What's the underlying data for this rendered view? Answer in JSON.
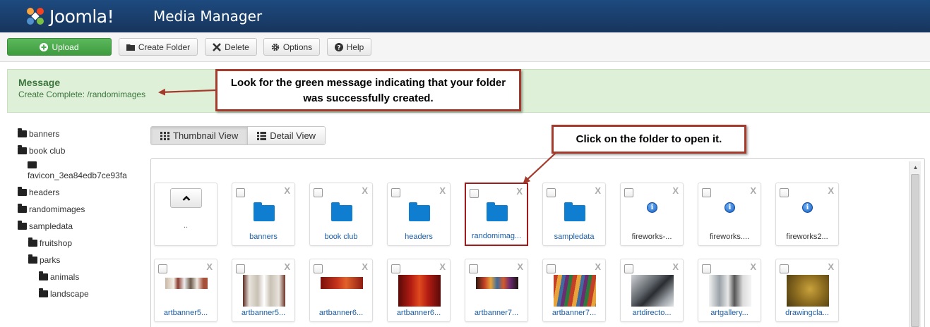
{
  "header": {
    "brand": "Joomla!",
    "title": "Media Manager"
  },
  "toolbar": {
    "upload": "Upload",
    "create_folder": "Create Folder",
    "delete": "Delete",
    "options": "Options",
    "help": "Help"
  },
  "message": {
    "heading": "Message",
    "text": "Create Complete: /randomimages"
  },
  "callouts": {
    "message_note": "Look for the green message indicating that your folder was successfully created.",
    "folder_note": "Click on the folder to open it."
  },
  "tree": [
    {
      "label": "banners"
    },
    {
      "label": "book club"
    },
    {
      "label": "favicon_3ea84edb7ce93fa"
    },
    {
      "label": "headers"
    },
    {
      "label": "randomimages"
    },
    {
      "label": "sampledata"
    },
    {
      "label": "fruitshop"
    },
    {
      "label": "parks"
    },
    {
      "label": "animals"
    },
    {
      "label": "landscape"
    }
  ],
  "views": {
    "thumbnail": "Thumbnail View",
    "detail": "Detail View"
  },
  "media": {
    "up_label": "..",
    "delete_mark": "X",
    "row1": [
      {
        "label": "banners",
        "kind": "folder"
      },
      {
        "label": "book club",
        "kind": "folder"
      },
      {
        "label": "headers",
        "kind": "folder"
      },
      {
        "label": "randomimag...",
        "kind": "folder"
      },
      {
        "label": "sampledata",
        "kind": "folder"
      },
      {
        "label": "fireworks-...",
        "kind": "file"
      },
      {
        "label": "fireworks....",
        "kind": "file"
      },
      {
        "label": "fireworks2...",
        "kind": "file"
      }
    ],
    "row2": [
      {
        "label": "artbanner5..."
      },
      {
        "label": "artbanner5..."
      },
      {
        "label": "artbanner6..."
      },
      {
        "label": "artbanner6..."
      },
      {
        "label": "artbanner7..."
      },
      {
        "label": "artbanner7..."
      },
      {
        "label": "artdirecto..."
      },
      {
        "label": "artgallery..."
      },
      {
        "label": "drawingcla..."
      }
    ]
  },
  "colors": {
    "header_bg": "#1a4273",
    "success_bg": "#dff0d8",
    "success_text": "#3c763d",
    "upload_green": "#4cae4c",
    "folder_blue": "#0f7ed0",
    "callout_border": "#a33a2c"
  }
}
